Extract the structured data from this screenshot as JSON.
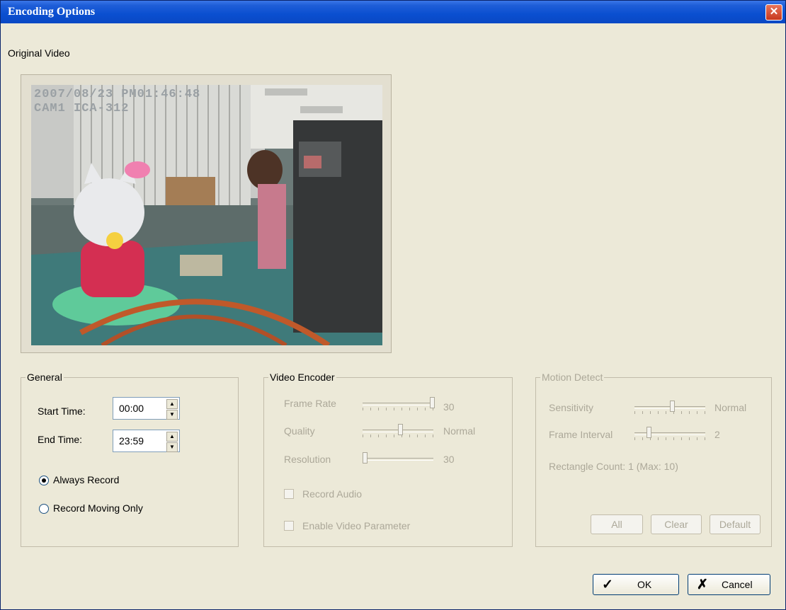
{
  "window": {
    "title": "Encoding Options",
    "close_icon": "close-icon"
  },
  "original_video": {
    "label": "Original Video",
    "osd_line1": "2007/08/23 PM01:46:48",
    "osd_line2": "CAM1 ICA-312"
  },
  "general": {
    "legend": "General",
    "start_label": "Start Time:",
    "start_value": "00:00",
    "end_label": "End Time:",
    "end_value": "23:59",
    "radio_always": "Always Record",
    "radio_moving": "Record Moving Only",
    "selected": "Always Record"
  },
  "video_encoder": {
    "legend": "Video Encoder",
    "frame_rate_label": "Frame Rate",
    "frame_rate_value": "30",
    "quality_label": "Quality",
    "quality_value": "Normal",
    "resolution_label": "Resolution",
    "resolution_value": "30",
    "record_audio": "Record Audio",
    "enable_video_param": "Enable Video Parameter"
  },
  "motion_detect": {
    "legend": "Motion Detect",
    "sensitivity_label": "Sensitivity",
    "sensitivity_value": "Normal",
    "frame_interval_label": "Frame Interval",
    "frame_interval_value": "2",
    "rect_count": "Rectangle Count: 1  (Max: 10)",
    "btn_all": "All",
    "btn_clear": "Clear",
    "btn_default": "Default"
  },
  "footer": {
    "ok": "OK",
    "cancel": "Cancel"
  },
  "colors": {
    "titlebar": "#0a4fd0",
    "dialog_bg": "#ece9d8",
    "disabled_text": "#aca899"
  }
}
